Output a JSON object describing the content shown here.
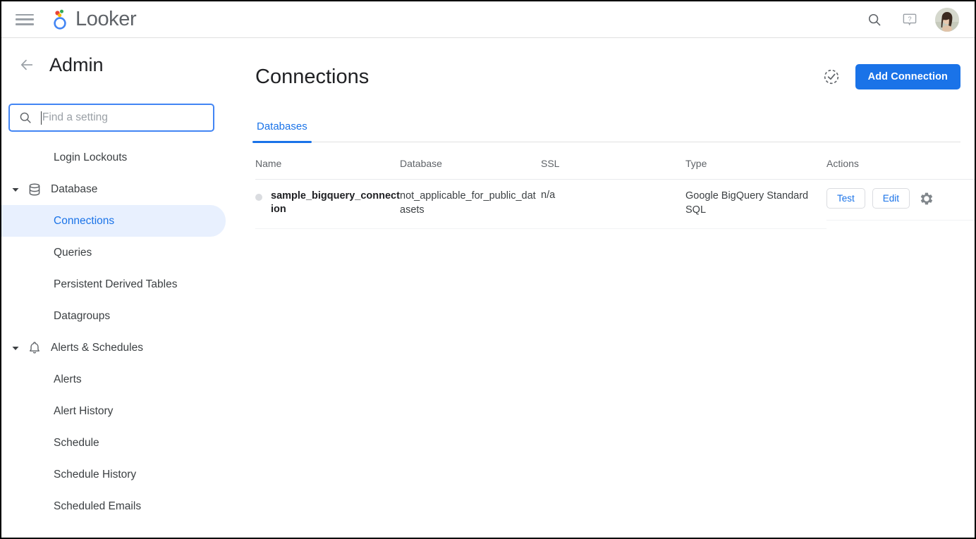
{
  "topbar": {
    "menu_icon": "hamburger-menu-icon",
    "brand": "Looker",
    "search_icon": "search-icon",
    "help_icon": "help-question-icon",
    "avatar": "user-avatar"
  },
  "sidebar": {
    "back_label": "back-arrow-icon",
    "title": "Admin",
    "search": {
      "placeholder": "Find a setting",
      "value": "",
      "icon": "search-icon"
    },
    "items": [
      {
        "label": "Login Lockouts",
        "type": "child",
        "selected": false
      },
      {
        "label": "Database",
        "type": "group",
        "icon": "database-icon",
        "expanded": true
      },
      {
        "label": "Connections",
        "type": "child",
        "selected": true
      },
      {
        "label": "Queries",
        "type": "child",
        "selected": false
      },
      {
        "label": "Persistent Derived Tables",
        "type": "child",
        "selected": false
      },
      {
        "label": "Datagroups",
        "type": "child",
        "selected": false
      },
      {
        "label": "Alerts & Schedules",
        "type": "group",
        "icon": "bell-icon",
        "expanded": true
      },
      {
        "label": "Alerts",
        "type": "child",
        "selected": false
      },
      {
        "label": "Alert History",
        "type": "child",
        "selected": false
      },
      {
        "label": "Schedule",
        "type": "child",
        "selected": false
      },
      {
        "label": "Schedule History",
        "type": "child",
        "selected": false
      },
      {
        "label": "Scheduled Emails",
        "type": "child",
        "selected": false
      }
    ]
  },
  "main": {
    "title": "Connections",
    "test_all_icon": "check-circle-dashed-icon",
    "add_button": "Add Connection",
    "tabs": [
      {
        "label": "Databases",
        "active": true
      }
    ],
    "table": {
      "columns": [
        "Name",
        "Database",
        "SSL",
        "Type",
        "Actions"
      ],
      "rows": [
        {
          "status": "inactive",
          "name": "sample_bigquery_connection",
          "database": "not_applicable_for_public_datasets",
          "ssl": "n/a",
          "type": "Google BigQuery Standard SQL",
          "actions": {
            "test": "Test",
            "edit": "Edit",
            "settings_icon": "gear-icon"
          }
        }
      ]
    }
  },
  "colors": {
    "accent": "#1a73e8",
    "selected_bg": "#e8f0fe",
    "text": "#3c4043",
    "muted": "#5f6368",
    "status_dot": "#dadce0"
  }
}
